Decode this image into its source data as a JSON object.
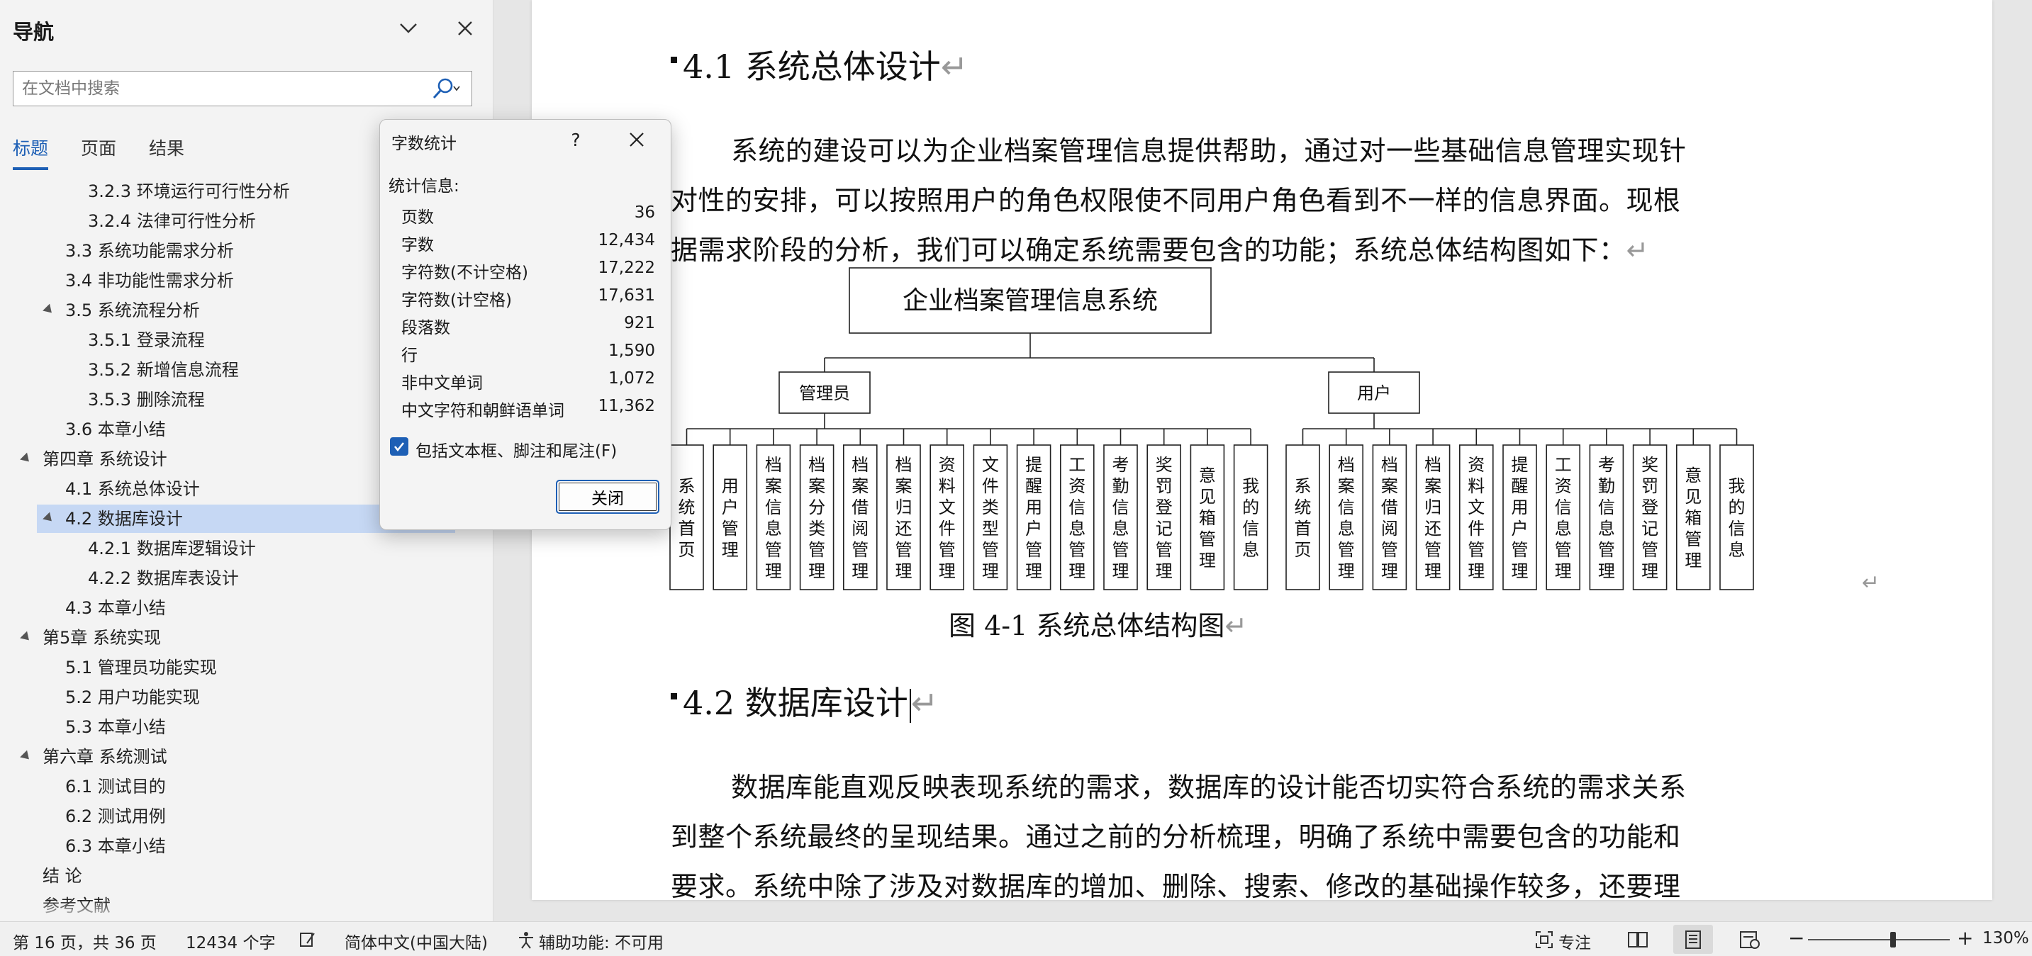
{
  "nav": {
    "title": "导航",
    "search_placeholder": "在文档中搜索",
    "tabs": [
      {
        "label": "标题",
        "active": true
      },
      {
        "label": "页面",
        "active": false
      },
      {
        "label": "结果",
        "active": false
      }
    ],
    "items": [
      {
        "label": "3.2.3 环境运行可行性分析",
        "level": 3,
        "expanded": null,
        "selected": false
      },
      {
        "label": "3.2.4 法律可行性分析",
        "level": 3,
        "expanded": null,
        "selected": false
      },
      {
        "label": "3.3 系统功能需求分析",
        "level": 2,
        "expanded": null,
        "selected": false
      },
      {
        "label": "3.4 非功能性需求分析",
        "level": 2,
        "expanded": null,
        "selected": false
      },
      {
        "label": "3.5 系统流程分析",
        "level": 2,
        "expanded": true,
        "selected": false
      },
      {
        "label": "3.5.1 登录流程",
        "level": 3,
        "expanded": null,
        "selected": false
      },
      {
        "label": "3.5.2 新增信息流程",
        "level": 3,
        "expanded": null,
        "selected": false
      },
      {
        "label": "3.5.3 删除流程",
        "level": 3,
        "expanded": null,
        "selected": false
      },
      {
        "label": "3.6 本章小结",
        "level": 2,
        "expanded": null,
        "selected": false
      },
      {
        "label": "第四章 系统设计",
        "level": 1,
        "expanded": true,
        "selected": false
      },
      {
        "label": "4.1 系统总体设计",
        "level": 2,
        "expanded": null,
        "selected": false
      },
      {
        "label": "4.2 数据库设计",
        "level": 2,
        "expanded": true,
        "selected": true
      },
      {
        "label": "4.2.1 数据库逻辑设计",
        "level": 3,
        "expanded": null,
        "selected": false
      },
      {
        "label": "4.2.2 数据库表设计",
        "level": 3,
        "expanded": null,
        "selected": false
      },
      {
        "label": "4.3 本章小结",
        "level": 2,
        "expanded": null,
        "selected": false
      },
      {
        "label": "第5章 系统实现",
        "level": 1,
        "expanded": true,
        "selected": false
      },
      {
        "label": "5.1 管理员功能实现",
        "level": 2,
        "expanded": null,
        "selected": false
      },
      {
        "label": "5.2 用户功能实现",
        "level": 2,
        "expanded": null,
        "selected": false
      },
      {
        "label": "5.3 本章小结",
        "level": 2,
        "expanded": null,
        "selected": false
      },
      {
        "label": "第六章 系统测试",
        "level": 1,
        "expanded": true,
        "selected": false
      },
      {
        "label": "6.1 测试目的",
        "level": 2,
        "expanded": null,
        "selected": false
      },
      {
        "label": "6.2 测试用例",
        "level": 2,
        "expanded": null,
        "selected": false
      },
      {
        "label": "6.3 本章小结",
        "level": 2,
        "expanded": null,
        "selected": false
      },
      {
        "label": "结 论",
        "level": 1,
        "expanded": null,
        "selected": false
      },
      {
        "label": "参考文献",
        "level": 1,
        "expanded": null,
        "selected": false
      }
    ]
  },
  "dialog": {
    "title": "字数统计",
    "help": "?",
    "section_label": "统计信息:",
    "stats": [
      {
        "label": "页数",
        "value": "36"
      },
      {
        "label": "字数",
        "value": "12,434"
      },
      {
        "label": "字符数(不计空格)",
        "value": "17,222"
      },
      {
        "label": "字符数(计空格)",
        "value": "17,631"
      },
      {
        "label": "段落数",
        "value": "921"
      },
      {
        "label": "行",
        "value": "1,590"
      },
      {
        "label": "非中文单词",
        "value": "1,072"
      },
      {
        "label": "中文字符和朝鲜语单词",
        "value": "11,362"
      }
    ],
    "checkbox_label": "包括文本框、脚注和尾注(F)",
    "checkbox_checked": true,
    "close_label": "关闭"
  },
  "document": {
    "heading1": "4.1  系统总体设计",
    "para1": [
      "系统的建设可以为企业档案管理信息提供帮助，通过对一些基础信息管理实现针",
      "对性的安排，可以按照用户的角色权限使不同用户角色看到不一样的信息界面。现根",
      "据需求阶段的分析，我们可以确定系统需要包含的功能；系统总体结构图如下："
    ],
    "diagram": {
      "root": "企业档案管理信息系统",
      "groups": [
        {
          "name": "管理员",
          "children": [
            "系统首页",
            "用户管理",
            "档案信息管理",
            "档案分类管理",
            "档案借阅管理",
            "档案归还管理",
            "资料文件管理",
            "文件类型管理",
            "提醒用户管理",
            "工资信息管理",
            "考勤信息管理",
            "奖罚登记管理",
            "意见箱管理",
            "我的信息"
          ]
        },
        {
          "name": "用户",
          "children": [
            "系统首页",
            "档案信息管理",
            "档案借阅管理",
            "档案归还管理",
            "资料文件管理",
            "提醒用户管理",
            "工资信息管理",
            "考勤信息管理",
            "奖罚登记管理",
            "意见箱管理",
            "我的信息"
          ]
        }
      ]
    },
    "caption": "图 4-1  系统总体结构图",
    "heading2": "4.2  数据库设计",
    "para2": [
      "数据库能直观反映表现系统的需求，数据库的设计能否切实符合系统的需求关系",
      "到整个系统最终的呈现结果。通过之前的分析梳理，明确了系统中需要包含的功能和",
      "要求。系统中除了涉及对数据库的增加、删除、搜索、修改的基础操作较多，还要理"
    ],
    "para_mark": "↵"
  },
  "status": {
    "page_info": "第 16 页，共 36 页",
    "word_count": "12434 个字",
    "language": "简体中文(中国大陆)",
    "accessibility": "辅助功能: 不可用",
    "focus": "专注",
    "zoom_percent": "130%",
    "zoom_minus": "−",
    "zoom_plus": "+",
    "zoom_level": 0.6
  }
}
